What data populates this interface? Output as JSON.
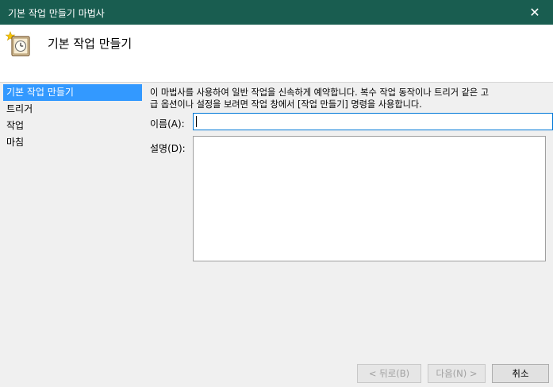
{
  "window": {
    "title": "기본 작업 만들기 마법사",
    "close_glyph": "✕",
    "title_bar_color": "#195d50"
  },
  "header": {
    "title": "기본 작업 만들기",
    "icon": "task-scheduler-clock-icon"
  },
  "nav": {
    "items": [
      {
        "label": "기본 작업 만들기",
        "active": true
      },
      {
        "label": "트리거",
        "active": false
      },
      {
        "label": "작업",
        "active": false
      },
      {
        "label": "마침",
        "active": false
      }
    ],
    "active_color": "#3399ff"
  },
  "main": {
    "description": "이 마법사를 사용하여 일반 작업을 신속하게 예약합니다. 복수 작업 동작이나 트리거 같은 고\n급 옵션이나 설정을 보려면 작업 창에서 [작업 만들기] 명령을 사용합니다.",
    "name_label": "이름(A):",
    "name_value": "",
    "desc_label": "설명(D):",
    "desc_value": ""
  },
  "buttons": {
    "back": "< 뒤로(B)",
    "next": "다음(N) >",
    "cancel": "취소"
  }
}
